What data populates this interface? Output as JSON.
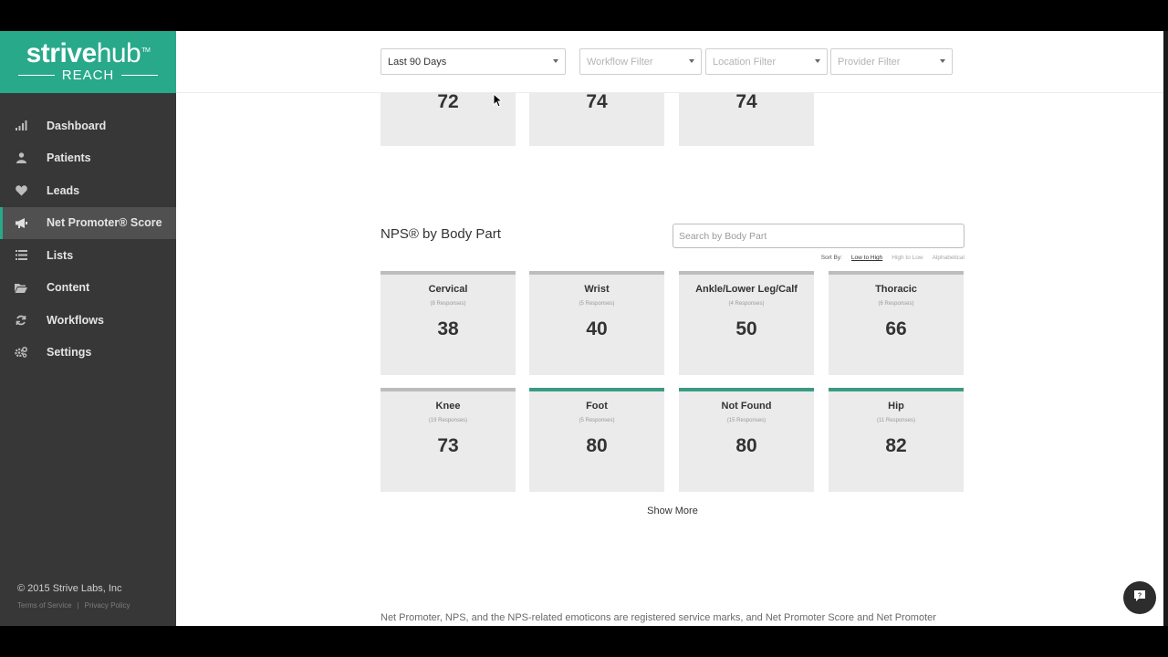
{
  "brand": {
    "name_bold": "strive",
    "name_light": "hub",
    "tm": "TM",
    "sub": "REACH"
  },
  "nav": [
    {
      "label": "Dashboard",
      "icon": "bar-chart-icon"
    },
    {
      "label": "Patients",
      "icon": "person-icon"
    },
    {
      "label": "Leads",
      "icon": "heart-icon"
    },
    {
      "label": "Net Promoter® Score",
      "icon": "megaphone-icon",
      "active": true
    },
    {
      "label": "Lists",
      "icon": "list-icon"
    },
    {
      "label": "Content",
      "icon": "folder-icon"
    },
    {
      "label": "Workflows",
      "icon": "refresh-icon"
    },
    {
      "label": "Settings",
      "icon": "gears-icon"
    }
  ],
  "footer": {
    "copyright": "© 2015 Strive Labs, Inc",
    "terms": "Terms of Service",
    "sep": "|",
    "privacy": "Privacy Policy"
  },
  "filters": {
    "date": "Last 90 Days",
    "workflow": "Workflow Filter",
    "location": "Location Filter",
    "provider": "Provider Filter"
  },
  "top_scores": [
    "72",
    "74",
    "74"
  ],
  "section": {
    "title": "NPS® by Body Part",
    "search_placeholder": "Search by Body Part",
    "sort_label": "Sort By:",
    "sort_options": [
      "Low to High",
      "High to Low",
      "Alphabetical"
    ]
  },
  "cards": [
    {
      "name": "Cervical",
      "responses": "(8 Responses)",
      "score": "38",
      "color": "#bdbdbd"
    },
    {
      "name": "Wrist",
      "responses": "(5 Responses)",
      "score": "40",
      "color": "#bdbdbd"
    },
    {
      "name": "Ankle/Lower Leg/Calf",
      "responses": "(4 Responses)",
      "score": "50",
      "color": "#bdbdbd"
    },
    {
      "name": "Thoracic",
      "responses": "(6 Responses)",
      "score": "66",
      "color": "#bdbdbd"
    },
    {
      "name": "Knee",
      "responses": "(19 Responses)",
      "score": "73",
      "color": "#bdbdbd"
    },
    {
      "name": "Foot",
      "responses": "(5 Responses)",
      "score": "80",
      "color": "#3a9b83"
    },
    {
      "name": "Not Found",
      "responses": "(15 Responses)",
      "score": "80",
      "color": "#3a9b83"
    },
    {
      "name": "Hip",
      "responses": "(11 Responses)",
      "score": "82",
      "color": "#3a9b83"
    }
  ],
  "show_more": "Show More",
  "disclaimer": "Net Promoter, NPS, and the NPS-related emoticons are registered service marks, and Net Promoter Score and Net Promoter",
  "colors": {
    "accent": "#27a98a",
    "sidebar": "#373737",
    "card": "#ebebeb"
  }
}
